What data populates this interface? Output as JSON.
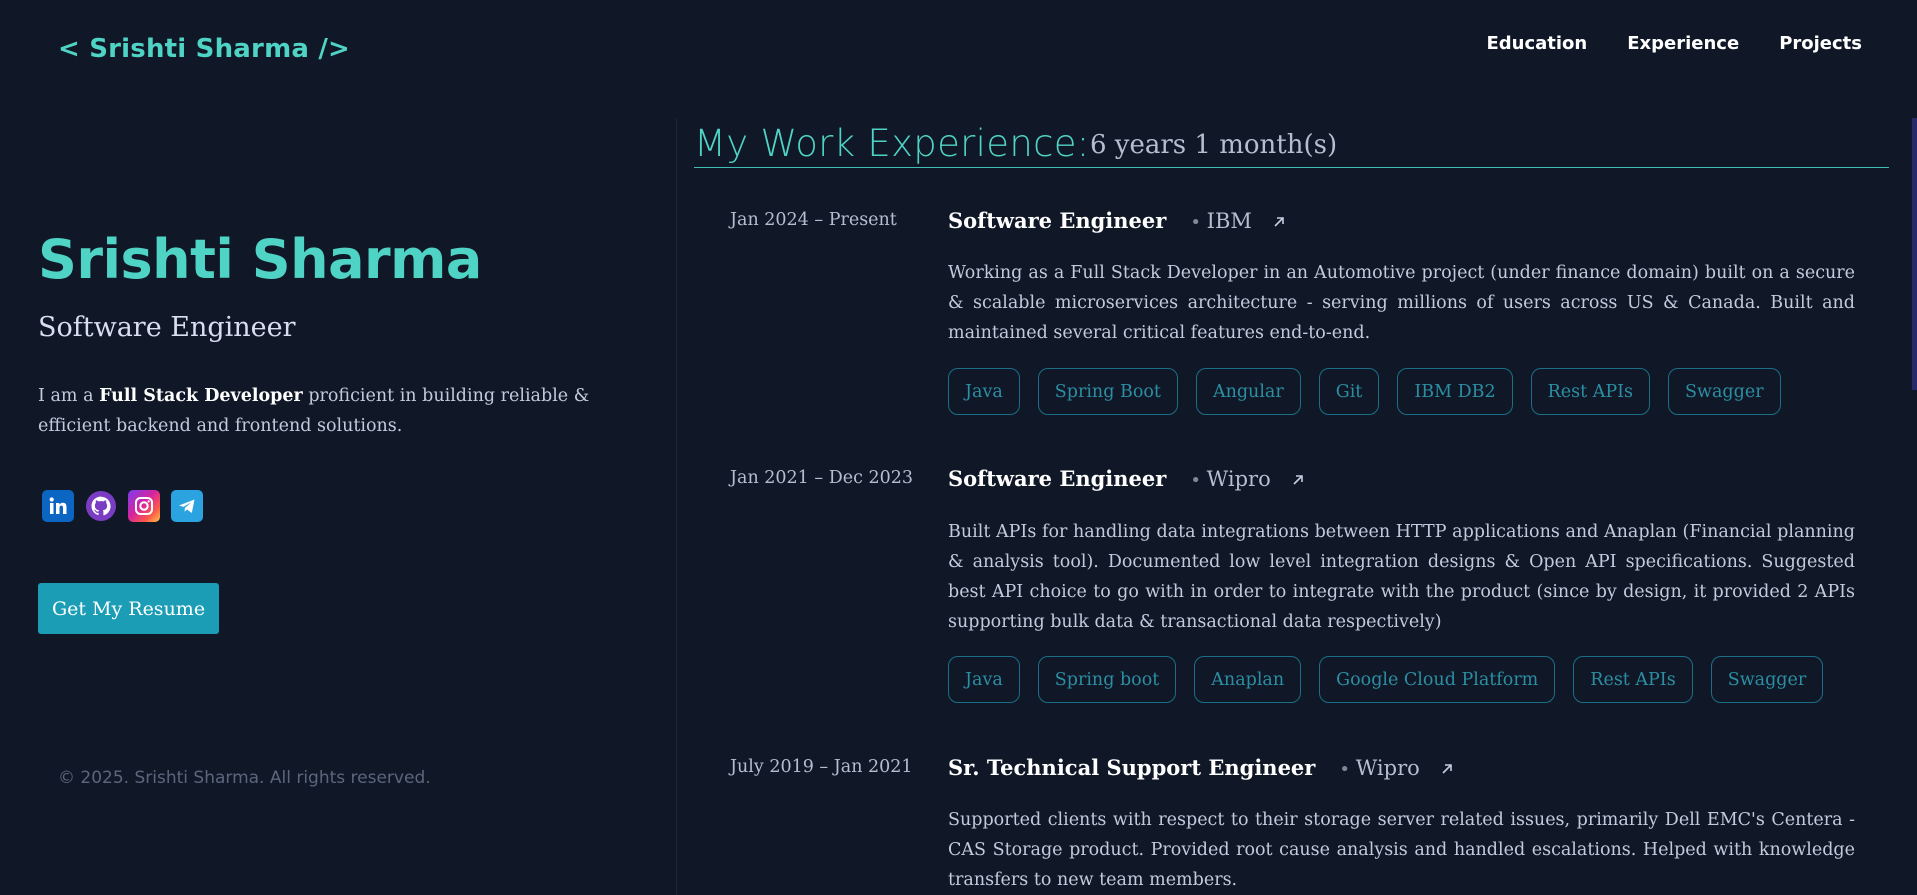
{
  "header": {
    "brand": "< Srishti Sharma />",
    "nav": [
      "Education",
      "Experience",
      "Projects"
    ]
  },
  "hero": {
    "name": "Srishti Sharma",
    "role": "Software Engineer",
    "bio_prefix": "I am a ",
    "bio_bold": "Full Stack Developer",
    "bio_suffix": " proficient in building reliable & efficient backend and frontend solutions.",
    "socials": [
      "linkedin-icon",
      "github-icon",
      "instagram-icon",
      "telegram-icon"
    ],
    "resume_button": "Get My Resume",
    "footer": "© 2025. Srishti Sharma. All rights reserved."
  },
  "experience": {
    "title": "My Work Experience:",
    "duration": "6 years 1 month(s)",
    "jobs": [
      {
        "date": "Jan 2024 – Present",
        "title": "Software Engineer",
        "company": "IBM",
        "description": "Working as a Full Stack Developer in an Automotive project (under finance domain) built on a secure & scalable microservices architecture - serving millions of users across US & Canada. Built and maintained several critical features end-to-end.",
        "tags": [
          "Java",
          "Spring Boot",
          "Angular",
          "Git",
          "IBM DB2",
          "Rest APIs",
          "Swagger"
        ]
      },
      {
        "date": "Jan 2021 – Dec 2023",
        "title": "Software Engineer",
        "company": "Wipro",
        "description": "Built APIs for handling data integrations between HTTP applications and Anaplan (Financial planning & analysis tool). Documented low level integration designs & Open API specifications. Suggested best API choice to go with in order to integrate with the product (since by design, it provided 2 APIs supporting bulk data & transactional data respectively)",
        "tags": [
          "Java",
          "Spring boot",
          "Anaplan",
          "Google Cloud Platform",
          "Rest APIs",
          "Swagger"
        ]
      },
      {
        "date": "July 2019 – Jan 2021",
        "title": "Sr. Technical Support Engineer",
        "company": "Wipro",
        "description": "Supported clients with respect to their storage server related issues, primarily Dell EMC's Centera - CAS Storage product. Provided root cause analysis and handled escalations. Helped with knowledge transfers to new team members.",
        "tags": []
      }
    ]
  },
  "colors": {
    "background": "#101827",
    "accent": "#4fd3c4",
    "button": "#1a9db5",
    "tag_border": "#1a6f87",
    "tag_text": "#2c8ea3"
  }
}
